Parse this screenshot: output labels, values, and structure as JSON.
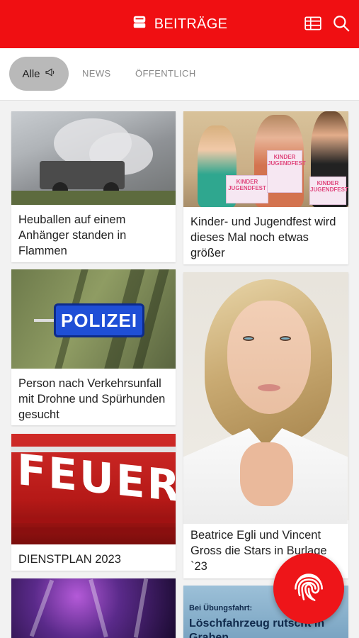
{
  "header": {
    "title": "BEITRÄGE",
    "brand_color": "#f00f12",
    "title_icon": "posts-icon",
    "actions": [
      {
        "name": "table-icon"
      },
      {
        "name": "search-icon"
      }
    ]
  },
  "tabs": {
    "active": {
      "label": "Alle",
      "icon": "megaphone-icon"
    },
    "items": [
      {
        "label": "NEWS"
      },
      {
        "label": "ÖFFENTLICH"
      }
    ]
  },
  "cards": {
    "c1": {
      "title": "Heuballen auf einem Anhänger standen in Flammen"
    },
    "c2": {
      "title": "Kinder- und Jugendfest wird dieses Mal noch etwas größer",
      "poster_text": "KINDER JUGENDFEST"
    },
    "c3": {
      "title": "Person nach Verkehrsunfall mit Drohne und Spürhunden gesucht",
      "sign_text": "POLIZEI"
    },
    "c4": {
      "title": "Beatrice Egli und Vincent Gross die Stars in Burlage `23"
    },
    "c5": {
      "title": "DIENSTPLAN 2023",
      "truck_text": "FEUERWE"
    },
    "c7": {
      "line1": "Bei Übungsfahrt:",
      "line2": "Löschfahrzeug rutscht in Graben"
    }
  },
  "fab": {
    "icon": "fingerprint-icon",
    "color": "#ee1519"
  }
}
